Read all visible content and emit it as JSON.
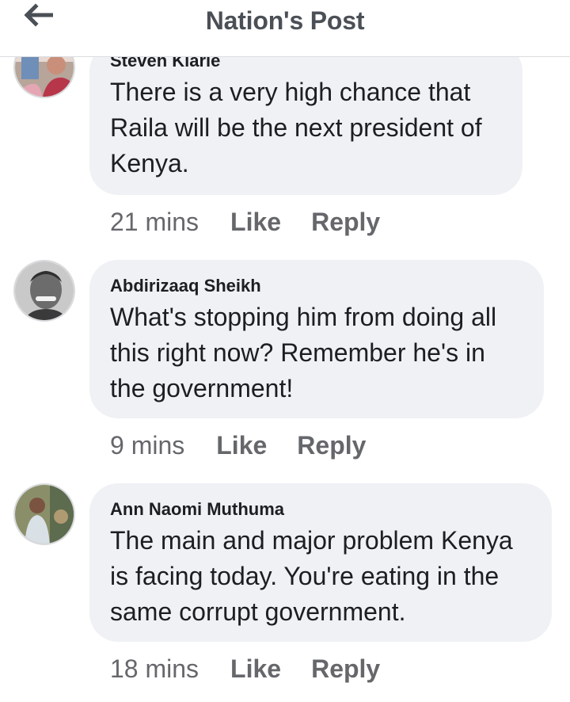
{
  "header": {
    "title": "Nation's Post",
    "back_icon": "arrow-left-icon"
  },
  "comments": [
    {
      "author": "Steven Kiarie",
      "text": "There is a very high chance that Raila will be the next president of Kenya.",
      "time": "21 mins",
      "like_label": "Like",
      "reply_label": "Reply"
    },
    {
      "author": "Abdirizaaq Sheikh",
      "text": "What's stopping him from doing all this right now? Remember he's in the government!",
      "time": "9 mins",
      "like_label": "Like",
      "reply_label": "Reply"
    },
    {
      "author": "Ann Naomi Muthuma",
      "text": "The main and major problem Kenya is facing today. You're eating in the same corrupt government.",
      "time": "18 mins",
      "like_label": "Like",
      "reply_label": "Reply"
    }
  ],
  "colors": {
    "bubble": "#f0f1f5",
    "text": "#1c1e21",
    "secondary": "#65676b",
    "header_title": "#4b4f56"
  }
}
